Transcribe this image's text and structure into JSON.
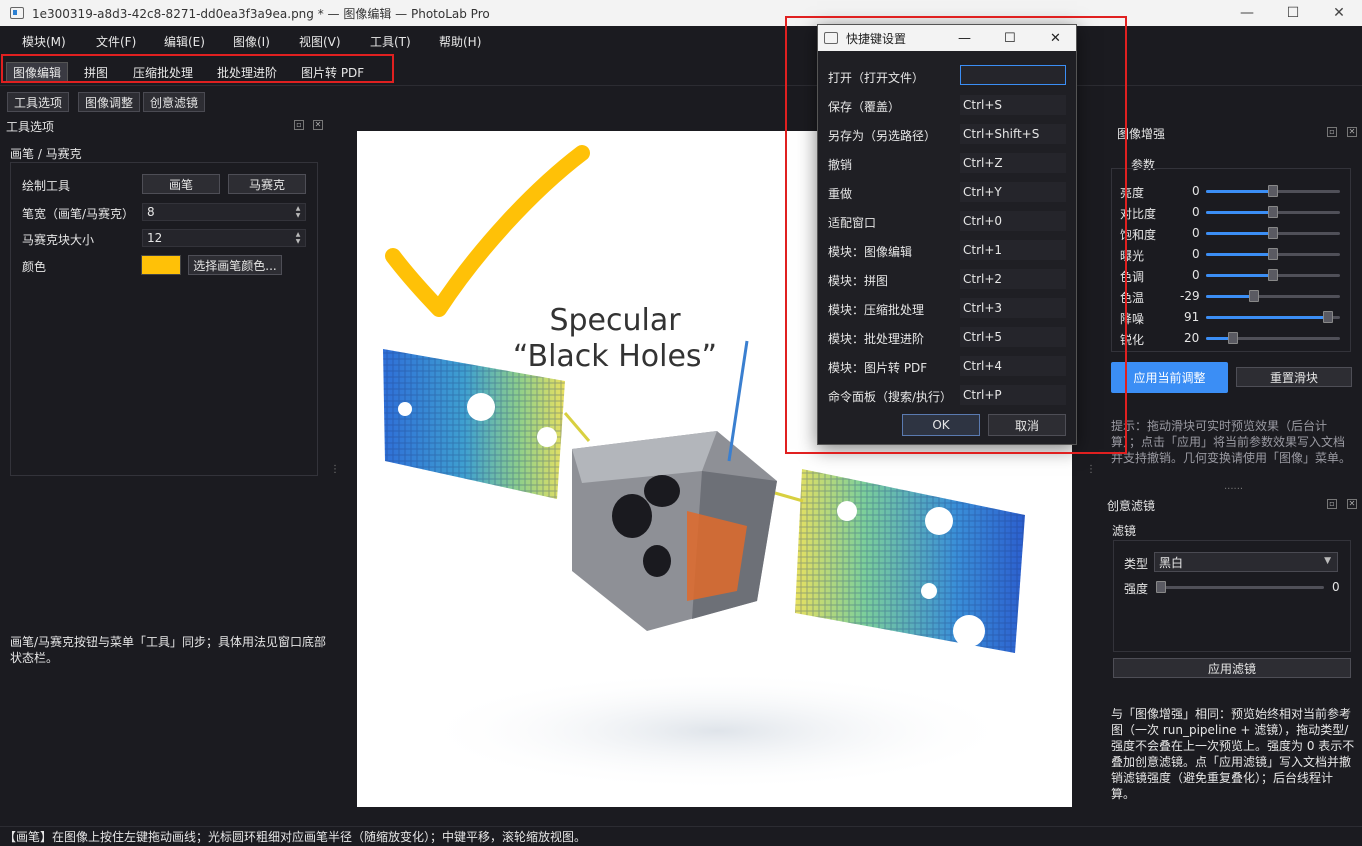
{
  "window": {
    "title": "1e300319-a8d3-42c8-8271-dd0ea3f3a9ea.png * — 图像编辑 — PhotoLab Pro",
    "minimize": "—",
    "maximize": "☐",
    "close": "✕"
  },
  "menu": [
    "模块(M)",
    "文件(F)",
    "编辑(E)",
    "图像(I)",
    "视图(V)",
    "工具(T)",
    "帮助(H)"
  ],
  "module_tabs": [
    "图像编辑",
    "拼图",
    "压缩批处理",
    "批处理进阶",
    "图片转 PDF"
  ],
  "toolbar": [
    "工具选项",
    "图像调整",
    "创意滤镜"
  ],
  "left_panel": {
    "header": "工具选项",
    "group_title": "画笔 / 马赛克",
    "draw_tool_label": "绘制工具",
    "brush_button": "画笔",
    "mosaic_button": "马赛克",
    "width_label": "笔宽（画笔/马赛克）",
    "width_value": "8",
    "mosaic_size_label": "马赛克块大小",
    "mosaic_size_value": "12",
    "color_label": "颜色",
    "color_value": "#ffc107",
    "choose_color_button": "选择画笔颜色...",
    "note": "画笔/马赛克按钮与菜单「工具」同步；具体用法见窗口底部状态栏。"
  },
  "canvas": {
    "caption_line1": "Specular",
    "caption_line2": "“Black Holes”"
  },
  "enhance_panel": {
    "header": "图像增强",
    "group_title": "参数",
    "sliders": [
      {
        "label": "亮度",
        "value": "0",
        "fraction": 0.5
      },
      {
        "label": "对比度",
        "value": "0",
        "fraction": 0.5
      },
      {
        "label": "饱和度",
        "value": "0",
        "fraction": 0.5
      },
      {
        "label": "曝光",
        "value": "0",
        "fraction": 0.5
      },
      {
        "label": "色调",
        "value": "0",
        "fraction": 0.5
      },
      {
        "label": "色温",
        "value": "-29",
        "fraction": 0.36
      },
      {
        "label": "降噪",
        "value": "91",
        "fraction": 0.91
      },
      {
        "label": "锐化",
        "value": "20",
        "fraction": 0.2
      }
    ],
    "apply_button": "应用当前调整",
    "reset_button": "重置滑块",
    "hint": "提示：拖动滑块可实时预览效果（后台计算）；点击「应用」将当前参数效果写入文档并支持撤销。几何变换请使用「图像」菜单。"
  },
  "filter_panel": {
    "header": "创意滤镜",
    "group_title": "滤镜",
    "type_label": "类型",
    "type_value": "黑白",
    "strength_label": "强度",
    "strength_value": "0",
    "apply_button": "应用滤镜",
    "note": "与「图像增强」相同：预览始终相对当前参考图（一次 run_pipeline + 滤镜），拖动类型/强度不会叠在上一次预览上。强度为 0 表示不叠加创意滤镜。点「应用滤镜」写入文档并撤销滤镜强度（避免重复叠化）；后台线程计算。"
  },
  "shortcut_dialog": {
    "title": "快捷键设置",
    "rows": [
      {
        "label": "打开（打开文件）",
        "value": ""
      },
      {
        "label": "保存（覆盖）",
        "value": "Ctrl+S"
      },
      {
        "label": "另存为（另选路径）",
        "value": "Ctrl+Shift+S"
      },
      {
        "label": "撤销",
        "value": "Ctrl+Z"
      },
      {
        "label": "重做",
        "value": "Ctrl+Y"
      },
      {
        "label": "适配窗口",
        "value": "Ctrl+0"
      },
      {
        "label": "模块：图像编辑",
        "value": "Ctrl+1"
      },
      {
        "label": "模块：拼图",
        "value": "Ctrl+2"
      },
      {
        "label": "模块：压缩批处理",
        "value": "Ctrl+3"
      },
      {
        "label": "模块：批处理进阶",
        "value": "Ctrl+5"
      },
      {
        "label": "模块：图片转 PDF",
        "value": "Ctrl+4"
      },
      {
        "label": "命令面板（搜索/执行）",
        "value": "Ctrl+P"
      }
    ],
    "ok_button": "OK",
    "cancel_button": "取消"
  },
  "status_bar": "【画笔】在图像上按住左键拖动画线；光标圆环粗细对应画笔半径（随缩放变化）；中键平移，滚轮缩放视图。"
}
